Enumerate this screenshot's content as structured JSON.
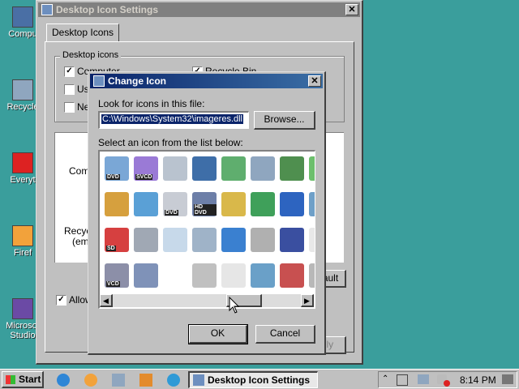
{
  "desktop": {
    "icons": [
      {
        "label": "Compu",
        "icon": "computer-icon"
      },
      {
        "label": "Recycle",
        "icon": "recycle-bin-icon"
      },
      {
        "label": "Everyt",
        "icon": "everything-icon"
      },
      {
        "label": "Firef",
        "icon": "firefox-icon"
      },
      {
        "label": "Microsof",
        "label2": "Studio",
        "icon": "visual-studio-icon"
      }
    ]
  },
  "parent_window": {
    "title": "Desktop Icon Settings",
    "tab": "Desktop Icons",
    "group_label": "Desktop icons",
    "checkboxes": [
      {
        "label": "Computer",
        "checked": true
      },
      {
        "label": "Us",
        "checked": false
      },
      {
        "label": "Ne",
        "checked": false
      },
      {
        "label": "Recycle Bin",
        "checked": true
      }
    ],
    "preview_labels": [
      "Comp",
      "Recyc",
      "(em"
    ],
    "allow_label": "Allow",
    "restore_default_fragment": "ault",
    "apply_fragment": "ply"
  },
  "dialog": {
    "title": "Change Icon",
    "look_label": "Look for icons in this file:",
    "file_path": "C:\\Windows\\System32\\imageres.dll",
    "browse_label": "Browse...",
    "select_label": "Select an icon from the list below:",
    "ok_label": "OK",
    "cancel_label": "Cancel",
    "icons": [
      {
        "name": "dvd-icon",
        "tag": "DVD"
      },
      {
        "name": "svcd-icon",
        "tag": "SVCD"
      },
      {
        "name": "disc-icon",
        "tag": ""
      },
      {
        "name": "monitor-icon",
        "tag": ""
      },
      {
        "name": "network-check-icon",
        "tag": ""
      },
      {
        "name": "recycle-bin-icon",
        "tag": ""
      },
      {
        "name": "screen-check-icon",
        "tag": ""
      },
      {
        "name": "check-icon",
        "tag": ""
      },
      {
        "name": "media-document-icon",
        "tag": ""
      },
      {
        "name": "music-note-icon",
        "tag": ""
      },
      {
        "name": "dvd-disc-icon",
        "tag": "DVD"
      },
      {
        "name": "hd-dvd-icon",
        "tag": "HD DVD"
      },
      {
        "name": "install-icon",
        "tag": ""
      },
      {
        "name": "sync-globe-icon",
        "tag": ""
      },
      {
        "name": "windows-flag-icon",
        "tag": ""
      },
      {
        "name": "network-icon",
        "tag": ""
      },
      {
        "name": "sd-card-icon",
        "tag": "SD"
      },
      {
        "name": "headphones-icon",
        "tag": ""
      },
      {
        "name": "cloud-icon",
        "tag": ""
      },
      {
        "name": "flower-icon",
        "tag": ""
      },
      {
        "name": "ie-icon",
        "tag": ""
      },
      {
        "name": "shortcut-icon",
        "tag": ""
      },
      {
        "name": "tools-icon",
        "tag": ""
      },
      {
        "name": "plus-icon",
        "tag": ""
      },
      {
        "name": "vcd-icon",
        "tag": "VCD"
      },
      {
        "name": "dvd-player-icon",
        "tag": ""
      },
      {
        "name": "blank-icon",
        "tag": ""
      },
      {
        "name": "cd-icon",
        "tag": ""
      },
      {
        "name": "document-icon",
        "tag": ""
      },
      {
        "name": "image-icon",
        "tag": ""
      },
      {
        "name": "photo-icon",
        "tag": ""
      },
      {
        "name": "drive-icon",
        "tag": ""
      }
    ]
  },
  "taskbar": {
    "start_label": "Start",
    "task_label": "Desktop Icon Settings",
    "clock": "8:14 PM",
    "quicklaunch": [
      "ie-icon",
      "firefox-icon",
      "network-icon",
      "media-icon",
      "globe-icon"
    ]
  },
  "colors": {
    "desktop": "#3a9e9c",
    "title_active": "#0a246a",
    "selection": "#0a246a"
  }
}
